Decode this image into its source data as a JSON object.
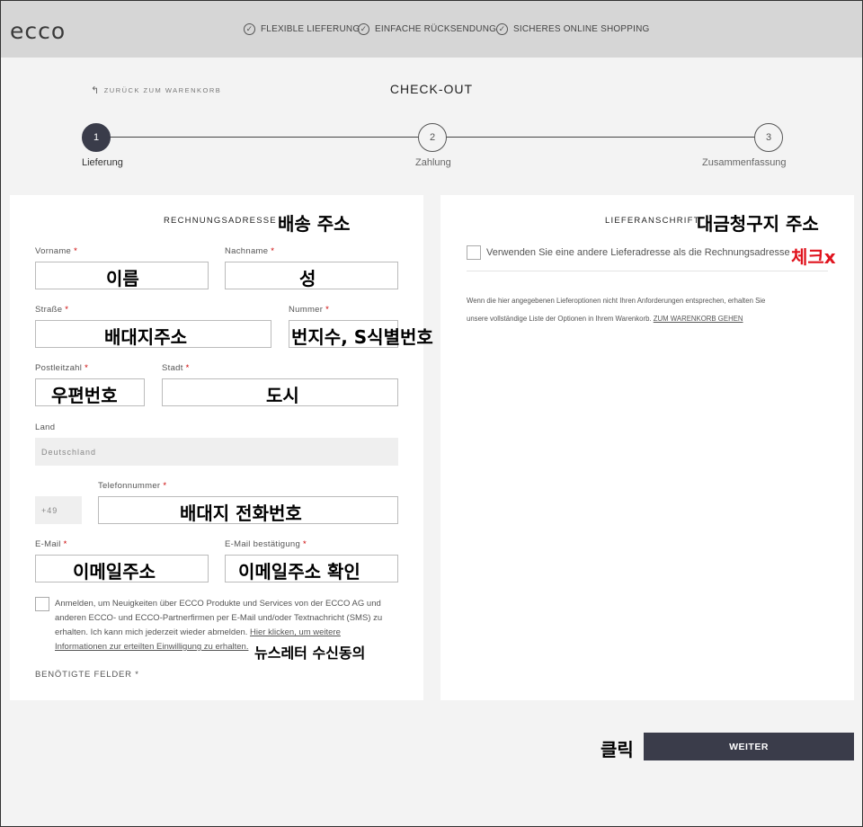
{
  "header": {
    "logo": "ecco",
    "usps": [
      "FLEXIBLE LIEFERUNG",
      "EINFACHE RÜCKSENDUNG",
      "SICHERES ONLINE SHOPPING"
    ]
  },
  "nav": {
    "back_label": "ZURÜCK ZUM WARENKORB",
    "page_title": "CHECK-OUT"
  },
  "steps": [
    {
      "number": "1",
      "label": "Lieferung"
    },
    {
      "number": "2",
      "label": "Zahlung"
    },
    {
      "number": "3",
      "label": "Zusammenfassung"
    }
  ],
  "billing": {
    "title": "RECHNUNGSADRESSE",
    "annotation_title": "배송 주소",
    "fields": {
      "firstname": {
        "label": "Vorname",
        "annotation": "이름"
      },
      "lastname": {
        "label": "Nachname",
        "annotation": "성"
      },
      "street": {
        "label": "Straße",
        "annotation": "배대지주소"
      },
      "number": {
        "label": "Nummer",
        "annotation": "번지수, S식별번호"
      },
      "zip": {
        "label": "Postleitzahl",
        "annotation": "우편번호"
      },
      "city": {
        "label": "Stadt",
        "annotation": "도시"
      },
      "country": {
        "label": "Land",
        "value": "Deutschland"
      },
      "prefix": {
        "value": "+49"
      },
      "phone": {
        "label": "Telefonnummer",
        "annotation": "배대지 전화번호"
      },
      "email": {
        "label": "E-Mail",
        "annotation": "이메일주소"
      },
      "email_confirm": {
        "label": "E-Mail bestätigung",
        "annotation": "이메일주소 확인"
      }
    },
    "required_marker": "*",
    "newsletter_text_1": "Anmelden, um Neuigkeiten über ECCO Produkte und Services von der ECCO AG und",
    "newsletter_text_2": "anderen ECCO- und ECCO-Partnerfirmen per E-Mail und/oder Textnachricht (SMS) zu",
    "newsletter_text_3": "erhalten. Ich kann mich jederzeit wieder abmelden.",
    "newsletter_link_1": "Hier klicken, um weitere",
    "newsletter_link_2": "Informationen zur erteilten Einwilligung zu erhalten.",
    "newsletter_annotation": "뉴스레터 수신동의",
    "required_fields": "BENÖTIGTE FELDER"
  },
  "delivery": {
    "title": "LIEFERANSCHRIFT",
    "annotation_title": "대금청구지 주소",
    "checkbox_label": "Verwenden Sie eine andere Lieferadresse als die Rechnungsadresse",
    "checkbox_annotation": "체크x",
    "info_1": "Wenn die hier angegebenen Lieferoptionen nicht Ihren Anforderungen entsprechen, erhalten Sie",
    "info_2": "unsere vollständige Liste der Optionen in Ihrem Warenkorb.",
    "info_link": "ZUM WARENKORB GEHEN"
  },
  "footer": {
    "continue_label": "WEITER",
    "continue_annotation": "클릭"
  }
}
